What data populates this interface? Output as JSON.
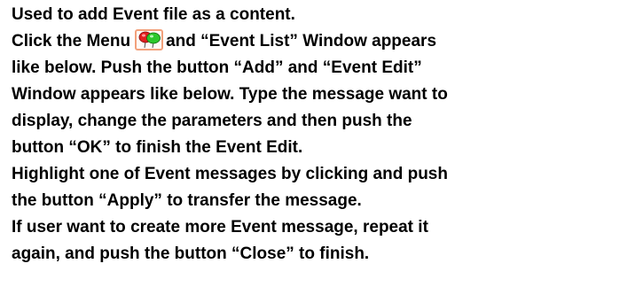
{
  "document": {
    "line1": "Used to add Event file as a content.",
    "line2_pre": "Click the Menu",
    "line2_post": "and “Event List” Window appears",
    "line3": "like below. Push the button “Add” and “Event Edit”",
    "line4": "Window appears like below. Type the message want to",
    "line5": "display, change the parameters and then push the",
    "line6": "button “OK” to finish the Event Edit.",
    "line7": "Highlight one of Event messages by clicking and push",
    "line8": "the button “Apply” to transfer the message.",
    "line9": "If user want to create more Event message, repeat it",
    "line10": "again, and push the button “Close” to finish."
  },
  "menu_icon": {
    "name": "event-balloons-icon",
    "colors": {
      "border": "#f2a17c",
      "left_balloon": "#e02020",
      "right_balloon": "#2cc82c"
    }
  }
}
